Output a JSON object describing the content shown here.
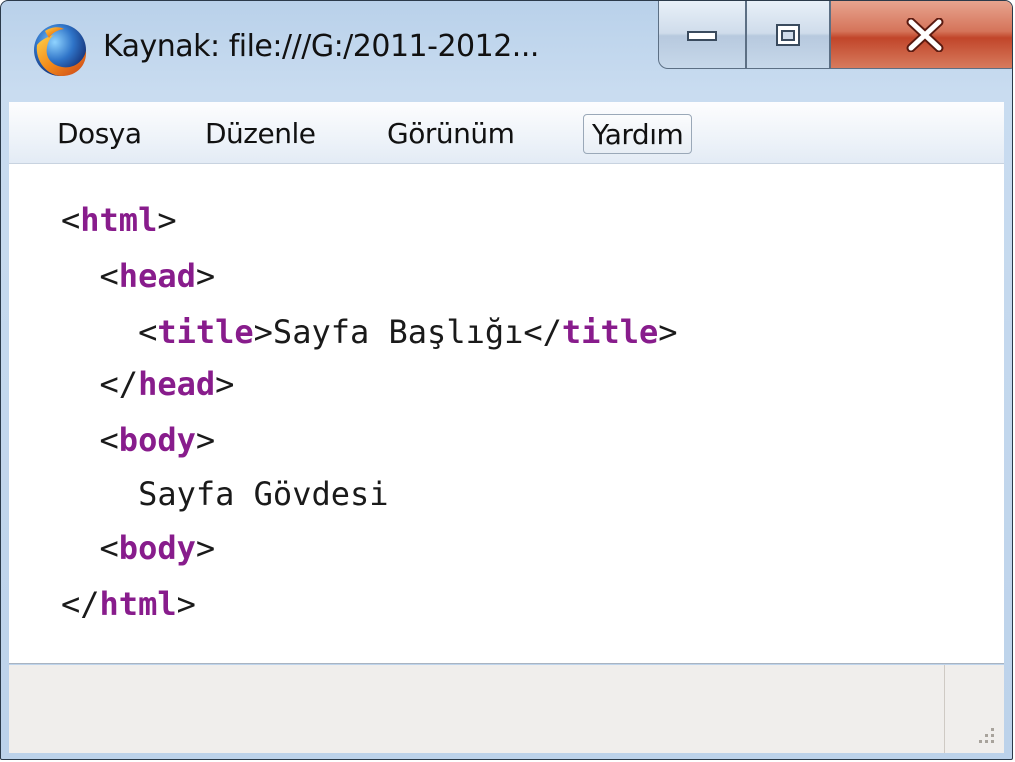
{
  "window": {
    "title": "Kaynak: file:///G:/2011-2012..."
  },
  "caption_buttons": {
    "minimize": "minimize-icon",
    "maximize": "maximize-icon",
    "close": "close-icon"
  },
  "menu": {
    "items": [
      {
        "label": "Dosya"
      },
      {
        "label": "Düzenle"
      },
      {
        "label": "Görünüm"
      },
      {
        "label": "Yardım"
      }
    ]
  },
  "source": {
    "lines": [
      {
        "indent": "",
        "open": "<",
        "tag": "html",
        "close": ">",
        "text": "",
        "open2": "",
        "tag2": "",
        "close2": ""
      },
      {
        "indent": "  ",
        "open": "<",
        "tag": "head",
        "close": ">",
        "text": "",
        "open2": "",
        "tag2": "",
        "close2": ""
      },
      {
        "indent": "    ",
        "open": "<",
        "tag": "title",
        "close": ">",
        "text": "Sayfa Başlığı",
        "open2": "</",
        "tag2": "title",
        "close2": ">"
      },
      {
        "indent": "  ",
        "open": "</",
        "tag": "head",
        "close": ">",
        "text": "",
        "open2": "",
        "tag2": "",
        "close2": ""
      },
      {
        "indent": "  ",
        "open": "<",
        "tag": "body",
        "close": ">",
        "text": "",
        "open2": "",
        "tag2": "",
        "close2": ""
      },
      {
        "indent": "    ",
        "open": "",
        "tag": "",
        "close": "",
        "text": "Sayfa Gövdesi",
        "open2": "",
        "tag2": "",
        "close2": ""
      },
      {
        "indent": "  ",
        "open": "<",
        "tag": "body",
        "close": ">",
        "text": "",
        "open2": "",
        "tag2": "",
        "close2": ""
      },
      {
        "indent": "",
        "open": "</",
        "tag": "html",
        "close": ">",
        "text": "",
        "open2": "",
        "tag2": "",
        "close2": ""
      }
    ]
  },
  "colors": {
    "tag": "#881c8c",
    "titlebar": "#b9d1ea",
    "close_button": "#c1452a"
  }
}
